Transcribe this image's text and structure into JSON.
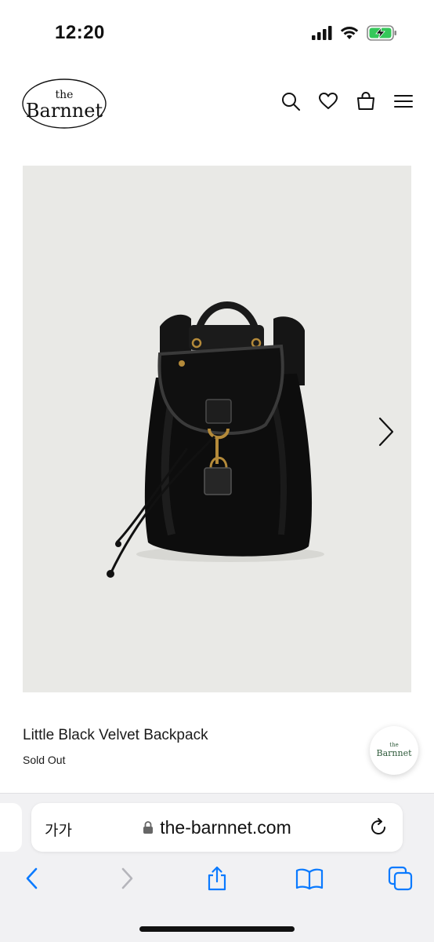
{
  "status_bar": {
    "time": "12:20",
    "icons": [
      "signal-icon",
      "wifi-icon",
      "battery-charging-icon"
    ],
    "battery_color": "#34c759"
  },
  "header": {
    "logo_small": "the",
    "logo_big": "Barnnet",
    "icons": [
      "search-icon",
      "heart-icon",
      "bag-icon",
      "menu-icon"
    ]
  },
  "product": {
    "image_alt": "Little Black Velvet Backpack",
    "title": "Little Black Velvet Backpack",
    "status": "Sold Out",
    "image_bg": "#e9e9e6"
  },
  "chat_badge": {
    "logo_small": "the",
    "logo_big": "Barnnet",
    "logo_color": "#2e5a3a"
  },
  "browser": {
    "text_size_label": "가가",
    "url": "the-barnnet.com",
    "toolbar_icons": [
      "back-icon",
      "forward-icon",
      "share-icon",
      "bookmarks-icon",
      "tabs-icon"
    ],
    "accent": "#0a7aff"
  }
}
